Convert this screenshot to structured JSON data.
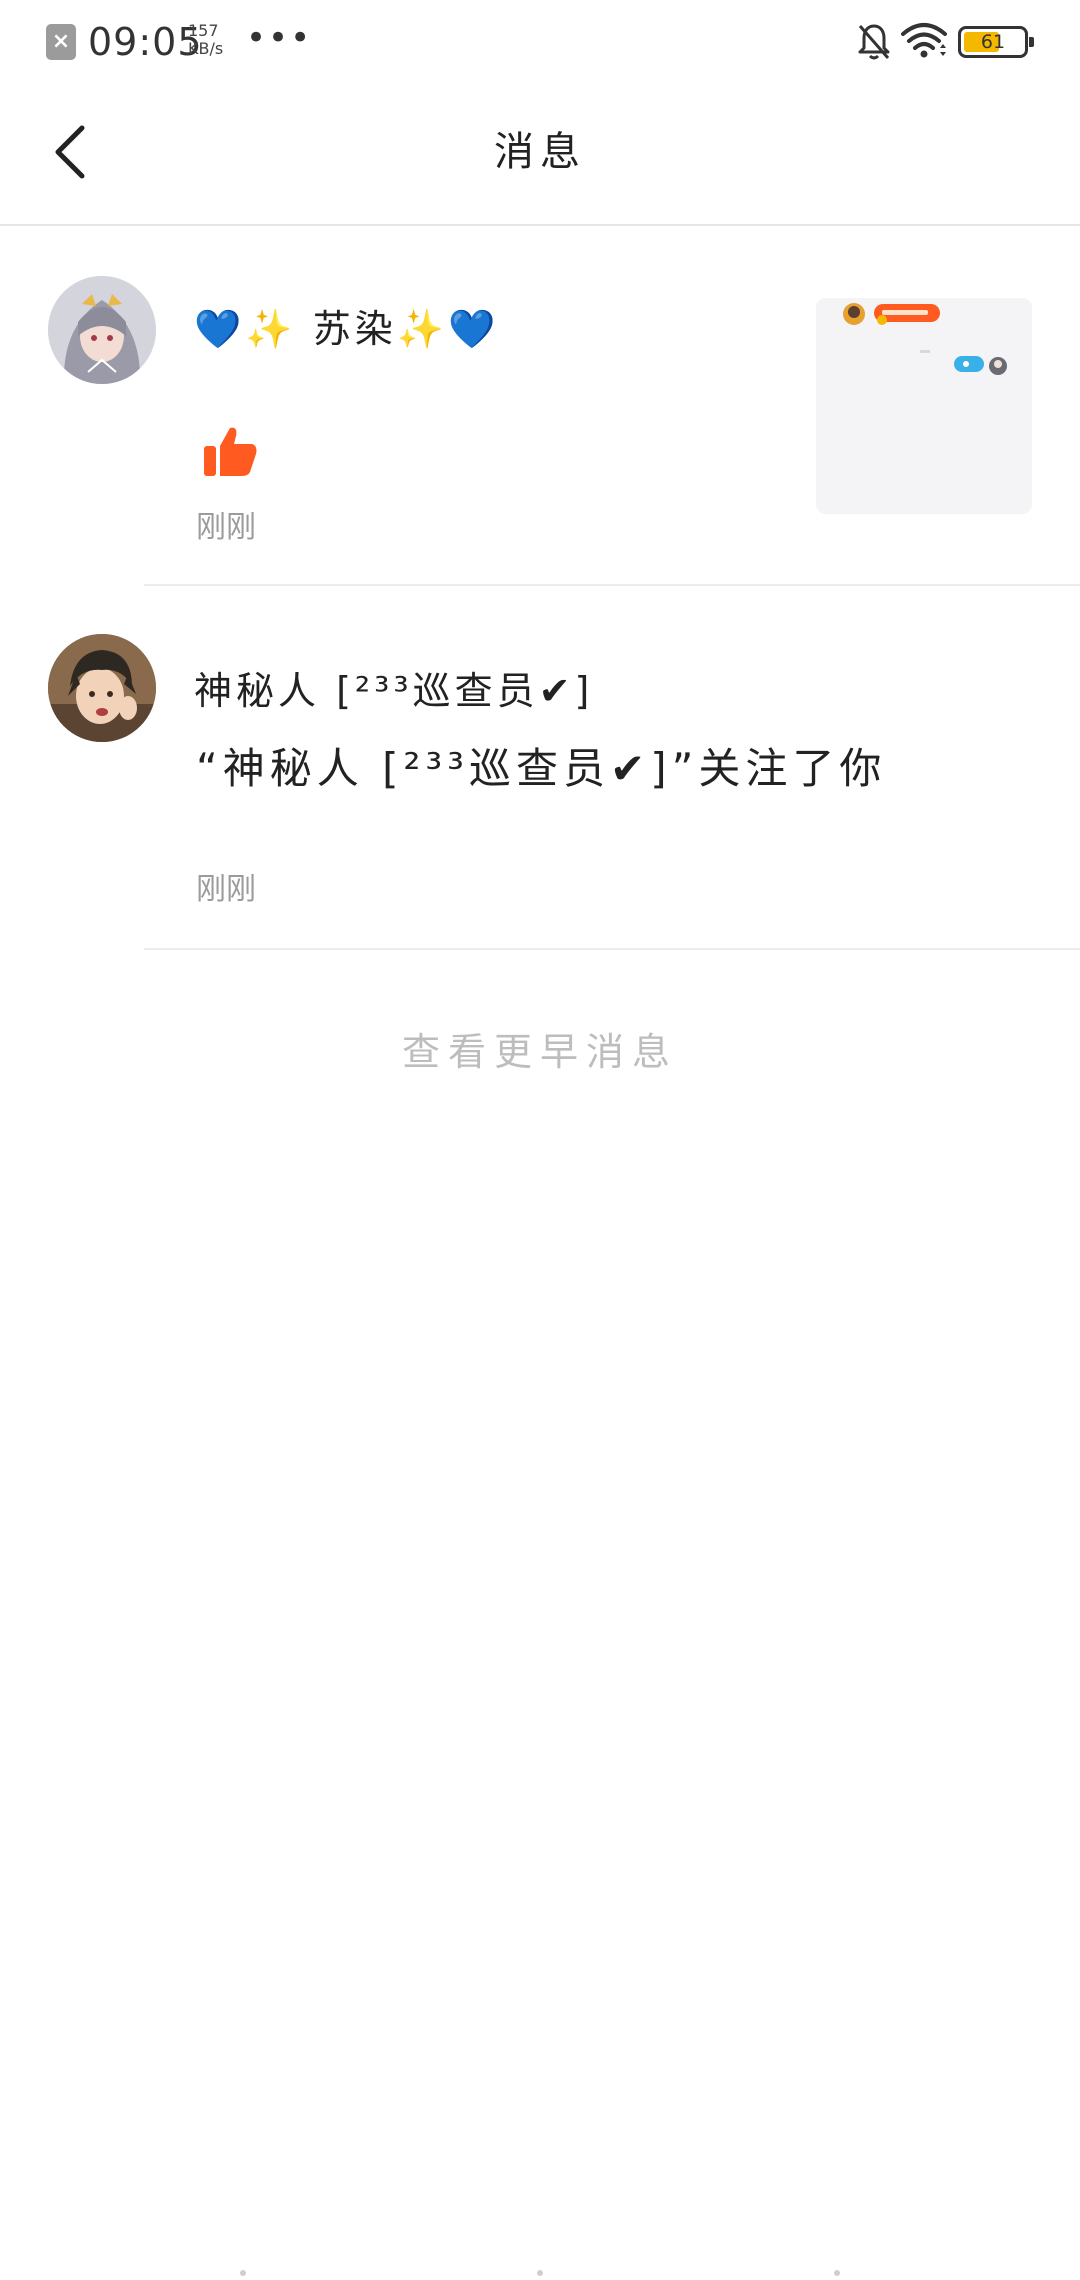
{
  "status_bar": {
    "sim_icon": "sim-off-icon",
    "time": "09:05",
    "net_speed_value": "157",
    "net_speed_unit": "KB/s",
    "more_dots": "•••",
    "mute_icon": "bell-off-icon",
    "wifi_icon": "wifi-icon",
    "battery_level": "61",
    "battery_color": "#f5b800"
  },
  "header": {
    "back_icon": "chevron-left-icon",
    "title": "消息"
  },
  "messages": [
    {
      "sender": "💙✨ 苏染✨💙",
      "action_icon": "thumbs-up-icon",
      "action_color": "#ff5a1f",
      "time": "刚刚",
      "has_thumbnail": true
    },
    {
      "sender": "神秘人 [²³³巡查员✔]",
      "text": "“神秘人 [²³³巡查员✔]”关注了你",
      "time": "刚刚"
    }
  ],
  "more_messages_label": "查看更早消息"
}
